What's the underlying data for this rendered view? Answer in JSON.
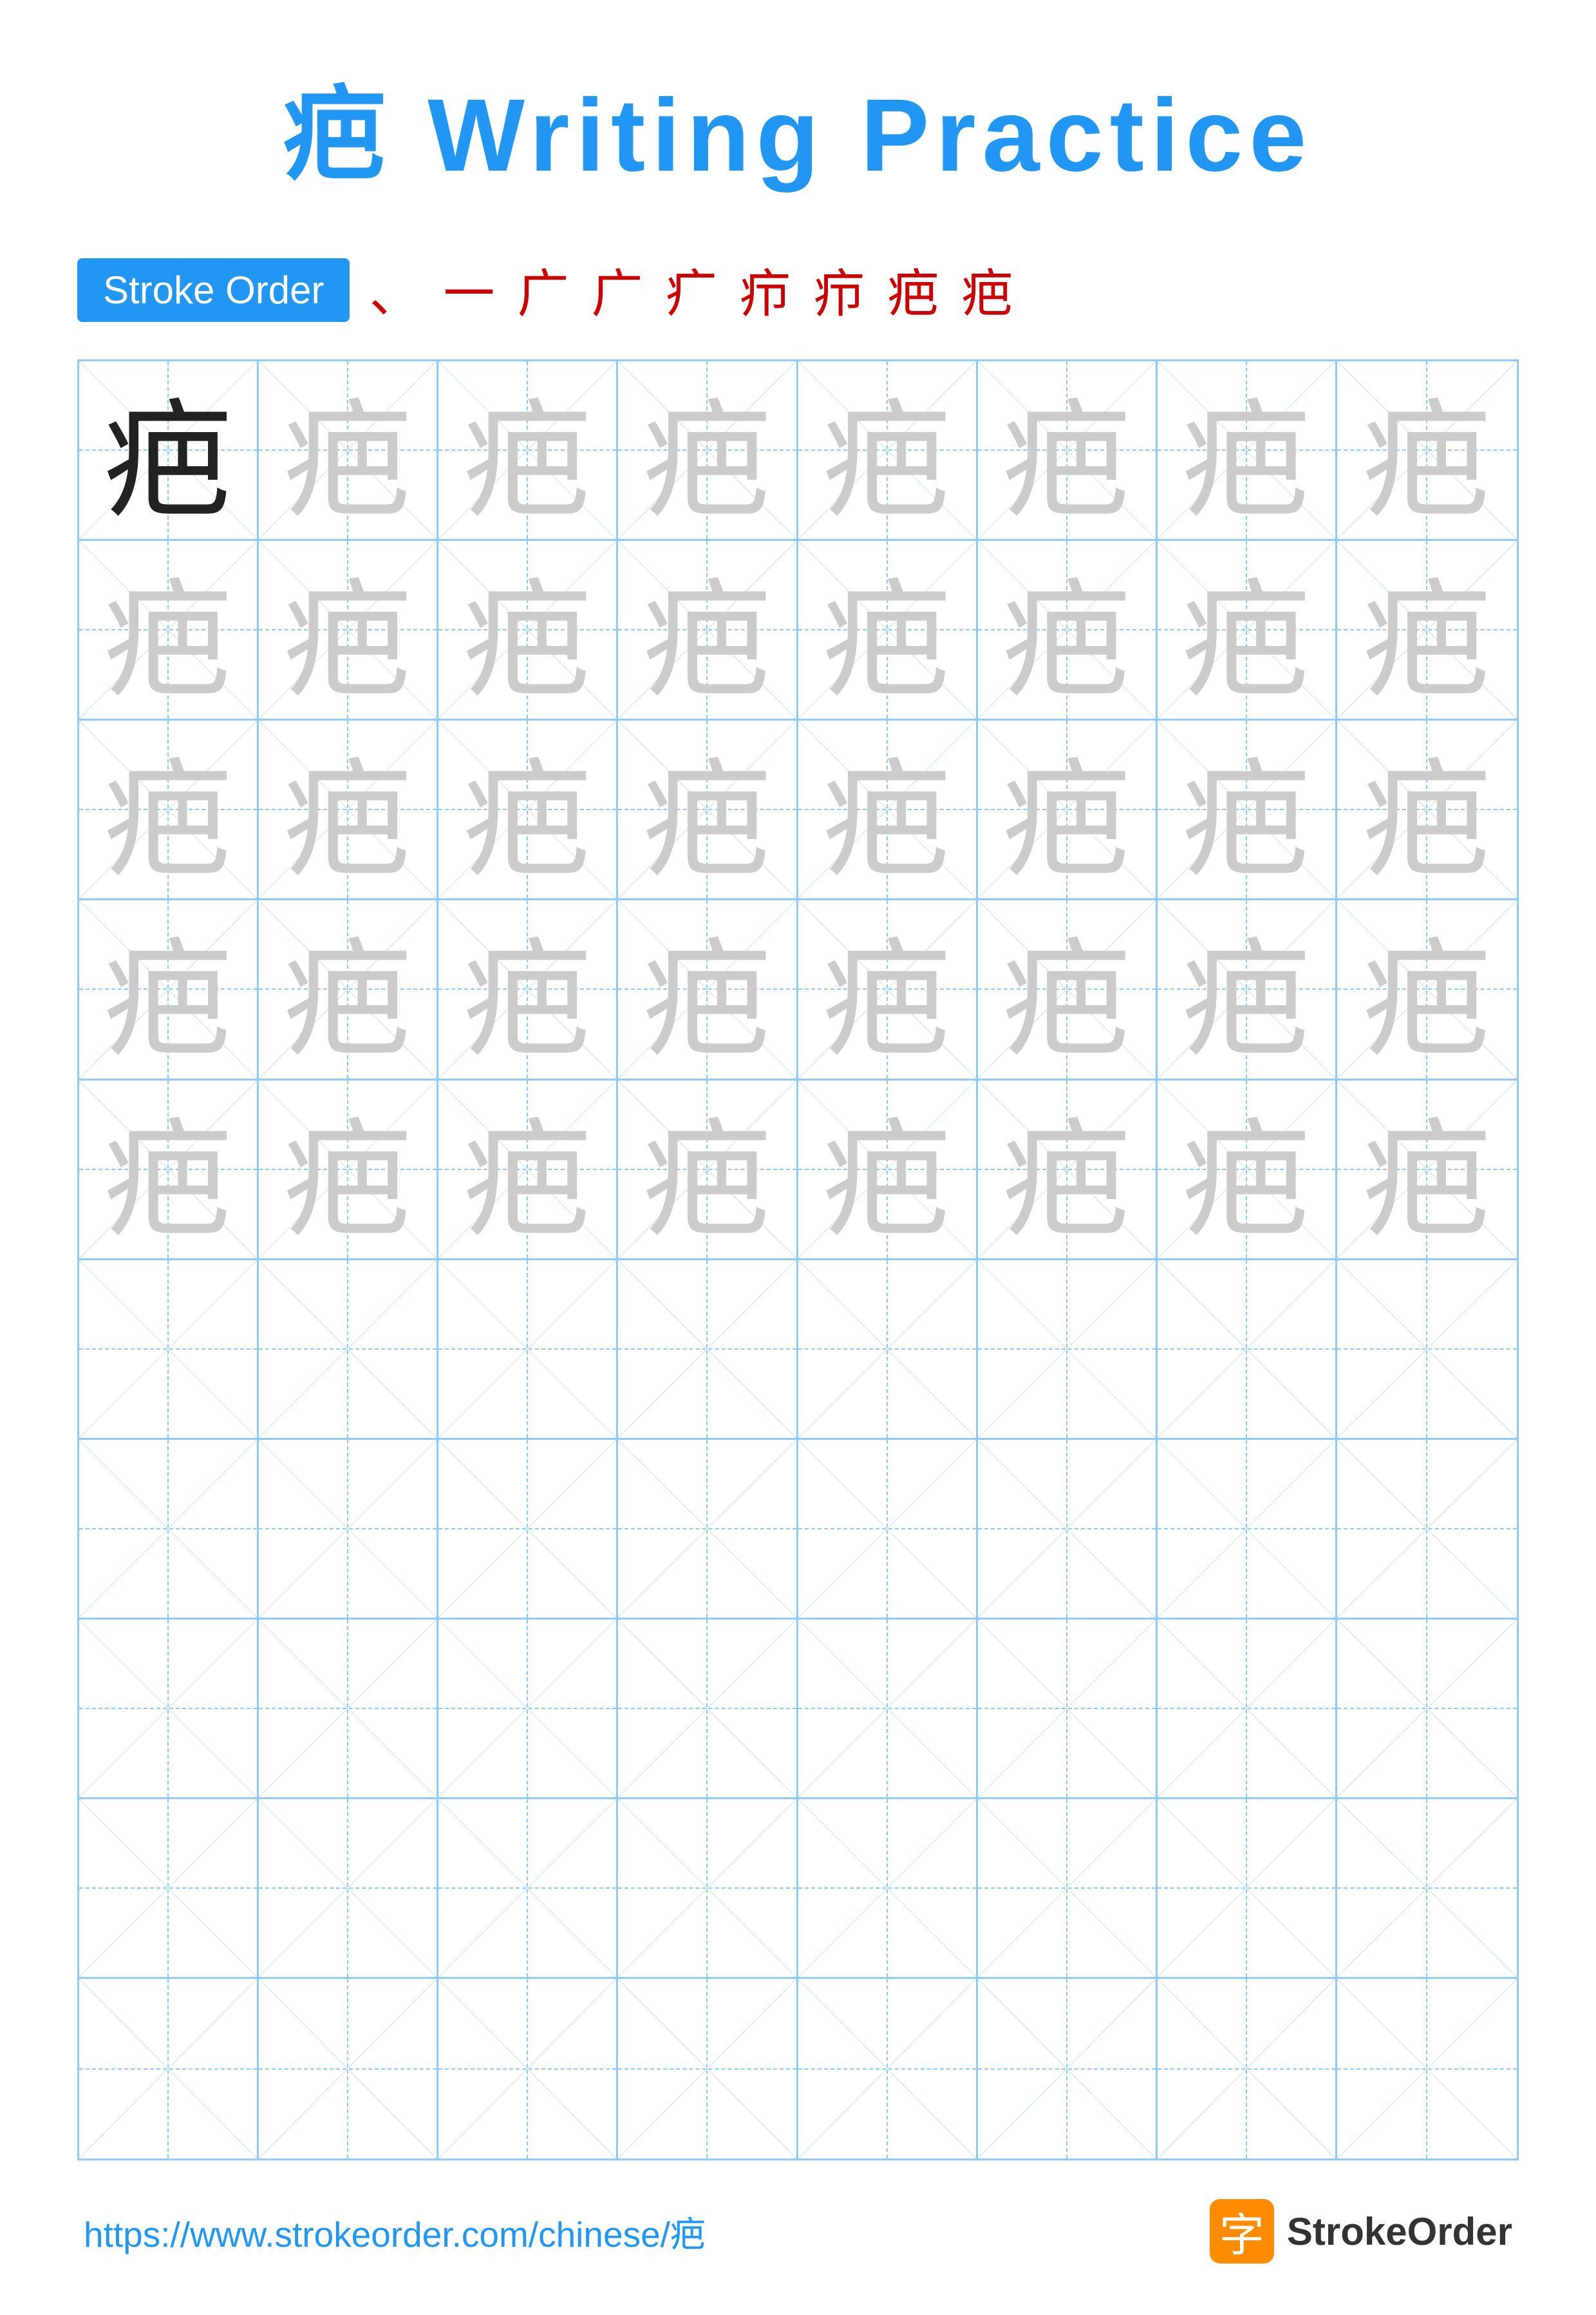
{
  "title": {
    "char": "疤",
    "suffix": " Writing Practice",
    "full": "疤 Writing Practice"
  },
  "stroke_order": {
    "badge_label": "Stroke Order",
    "strokes": [
      "、",
      "一",
      "广",
      "广",
      "疒",
      "疖",
      "疖",
      "疤",
      "疤"
    ]
  },
  "grid": {
    "rows": 10,
    "cols": 8,
    "char": "疤",
    "practice_rows": 5,
    "empty_rows": 5
  },
  "footer": {
    "url": "https://www.strokeorder.com/chinese/疤",
    "brand_char": "字",
    "brand_name": "StrokeOrder"
  },
  "colors": {
    "title_blue": "#2196F3",
    "stroke_order_red": "#cc0000",
    "badge_bg": "#2196F3",
    "grid_blue": "#90CAF9",
    "char_dark": "#222222",
    "char_light": "#cccccc"
  }
}
